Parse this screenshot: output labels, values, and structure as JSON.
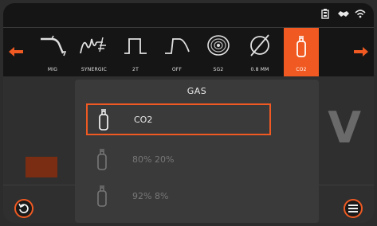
{
  "toolbar": {
    "items": [
      {
        "label": "MIG",
        "icon": "mig-torch-icon"
      },
      {
        "label": "SYNERGIC",
        "icon": "synergic-icon"
      },
      {
        "label": "2T",
        "icon": "2t-trigger-icon"
      },
      {
        "label": "OFF",
        "icon": "off-curve-icon"
      },
      {
        "label": "SG2",
        "icon": "wire-spool-icon"
      },
      {
        "label": "0.8 MM",
        "icon": "diameter-icon"
      },
      {
        "label": "CO2",
        "icon": "gas-cylinder-icon",
        "active": true
      }
    ]
  },
  "background": {
    "voltage_unit": "V"
  },
  "dialog": {
    "title": "GAS",
    "options": [
      {
        "label": "CO2",
        "selected": true
      },
      {
        "label": "80% 20%",
        "selected": false
      },
      {
        "label": "92% 8%",
        "selected": false
      }
    ]
  },
  "colors": {
    "accent": "#f05a22",
    "toolbar_bg": "#151515",
    "dialog_bg": "#3a3a3a"
  }
}
